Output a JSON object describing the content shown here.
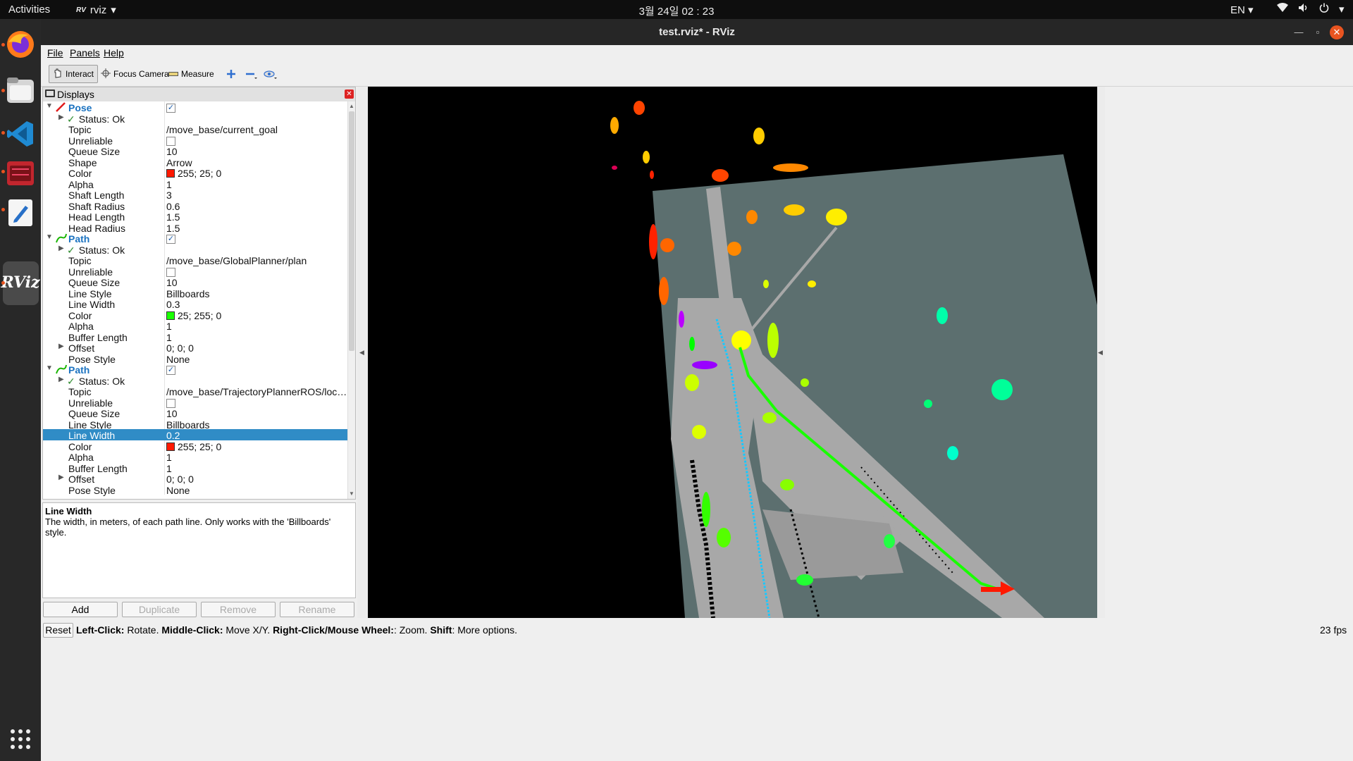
{
  "topbar": {
    "activities": "Activities",
    "app_name": "rviz",
    "clock": "3월 24일  02 : 23",
    "lang": "EN"
  },
  "dock": {
    "items": [
      "firefox-icon",
      "files-icon",
      "vscode-icon",
      "app-icon",
      "text-editor-icon",
      "rviz-icon",
      "show-apps-icon"
    ],
    "rviz_label": "RViz"
  },
  "window": {
    "title": "test.rviz* - RViz"
  },
  "menu": {
    "file": "File",
    "panels": "Panels",
    "help": "Help"
  },
  "toolbar": {
    "interact": "Interact",
    "focus_camera": "Focus Camera",
    "measure": "Measure"
  },
  "displays": {
    "title": "Displays",
    "pose": {
      "name": "Pose",
      "status": "Status: Ok",
      "topic_k": "Topic",
      "topic_v": "/move_base/current_goal",
      "unreliable_k": "Unreliable",
      "queue_k": "Queue Size",
      "queue_v": "10",
      "shape_k": "Shape",
      "shape_v": "Arrow",
      "color_k": "Color",
      "color_v": "255; 25; 0",
      "color_hex": "#ff1900",
      "alpha_k": "Alpha",
      "alpha_v": "1",
      "shaft_len_k": "Shaft Length",
      "shaft_len_v": "3",
      "shaft_rad_k": "Shaft Radius",
      "shaft_rad_v": "0.6",
      "head_len_k": "Head Length",
      "head_len_v": "1.5",
      "head_rad_k": "Head Radius",
      "head_rad_v": "1.5"
    },
    "path1": {
      "name": "Path",
      "status": "Status: Ok",
      "topic_k": "Topic",
      "topic_v": "/move_base/GlobalPlanner/plan",
      "unreliable_k": "Unreliable",
      "queue_k": "Queue Size",
      "queue_v": "10",
      "style_k": "Line Style",
      "style_v": "Billboards",
      "width_k": "Line Width",
      "width_v": "0.3",
      "color_k": "Color",
      "color_v": "25; 255; 0",
      "color_hex": "#19ff00",
      "alpha_k": "Alpha",
      "alpha_v": "1",
      "buffer_k": "Buffer Length",
      "buffer_v": "1",
      "offset_k": "Offset",
      "offset_v": "0; 0; 0",
      "pose_style_k": "Pose Style",
      "pose_style_v": "None"
    },
    "path2": {
      "name": "Path",
      "status": "Status: Ok",
      "topic_k": "Topic",
      "topic_v": "/move_base/TrajectoryPlannerROS/local_plan",
      "unreliable_k": "Unreliable",
      "queue_k": "Queue Size",
      "queue_v": "10",
      "style_k": "Line Style",
      "style_v": "Billboards",
      "width_k": "Line Width",
      "width_v": "0.2",
      "color_k": "Color",
      "color_v": "255; 25; 0",
      "color_hex": "#ff1900",
      "alpha_k": "Alpha",
      "alpha_v": "1",
      "buffer_k": "Buffer Length",
      "buffer_v": "1",
      "offset_k": "Offset",
      "offset_v": "0; 0; 0",
      "pose_style_k": "Pose Style",
      "pose_style_v": "None"
    }
  },
  "help": {
    "title": "Line Width",
    "text": "The width, in meters, of each path line. Only works with the 'Billboards' style."
  },
  "buttons": {
    "add": "Add",
    "duplicate": "Duplicate",
    "remove": "Remove",
    "rename": "Rename"
  },
  "statusbar": {
    "reset": "Reset",
    "left_click_k": "Left-Click:",
    "left_click_v": " Rotate. ",
    "middle_click_k": "Middle-Click:",
    "middle_click_v": " Move X/Y. ",
    "right_click_k": "Right-Click/Mouse Wheel:",
    "right_click_v": ": Zoom. ",
    "shift_k": "Shift",
    "shift_v": ": More options.",
    "fps": "23 fps"
  },
  "colors": {
    "selection": "#308cc6",
    "global_plan": "#19ff00",
    "local_plan": "#ff1900",
    "map_free": "#a8a8a8",
    "map_unknown": "#5c6f6f"
  }
}
